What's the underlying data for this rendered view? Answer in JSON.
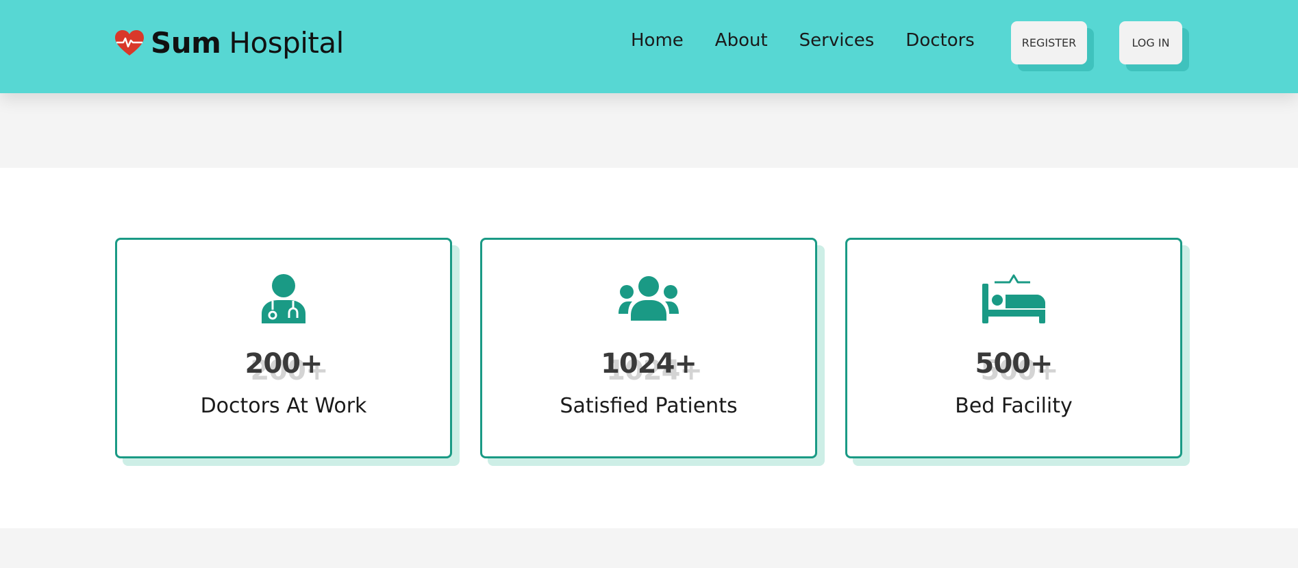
{
  "brand": {
    "bold": "Sum",
    "rest": "Hospital"
  },
  "nav": {
    "home": "Home",
    "about": "About",
    "services": "Services",
    "doctors": "Doctors"
  },
  "buttons": {
    "register": "REGISTER",
    "login": "LOG IN"
  },
  "stats": [
    {
      "value": "200+",
      "label": "Doctors At Work",
      "icon": "doctor-icon"
    },
    {
      "value": "1024+",
      "label": "Satisfied Patients",
      "icon": "users-icon"
    },
    {
      "value": "500+",
      "label": "Bed Facility",
      "icon": "bed-icon"
    }
  ],
  "colors": {
    "header_bg": "#57d7d3",
    "accent": "#1a9a85",
    "heart": "#d9382a",
    "card_shadow": "#cdeee6"
  }
}
